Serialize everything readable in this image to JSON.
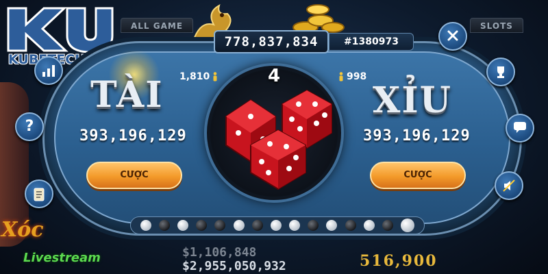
{
  "logo": {
    "text": "KUBETECH.NET"
  },
  "background": {
    "tab_left": "ALL GAME",
    "tab_right": "SLOTS",
    "xoc_label": "Xóc",
    "livestream_label": "Livestream",
    "amount_faded": "$1,106,848",
    "amount": "$2,955,050,932",
    "slot_number": "516,900"
  },
  "header": {
    "jackpot": "778,837,834",
    "session": "#1380973"
  },
  "timer": "4",
  "tai": {
    "label": "TÀI",
    "players": "1,810",
    "total": "393,196,129",
    "bet_label": "CƯỢC"
  },
  "xiu": {
    "label": "XỈU",
    "players": "998",
    "total": "393,196,129",
    "bet_label": "CƯỢC"
  },
  "history": [
    "w",
    "b",
    "w",
    "b",
    "b",
    "w",
    "b",
    "w",
    "w",
    "b",
    "w",
    "b",
    "w",
    "b",
    "w"
  ],
  "colors": {
    "table": "#2b5f8f",
    "bet_button": "#f39a2a",
    "logo": "#2d5d9a"
  },
  "buttons": {
    "left": [
      "chart-icon",
      "help-icon",
      "history-scroll-icon"
    ],
    "right": [
      "close-icon",
      "trophy-icon",
      "chat-icon",
      "sound-off-icon"
    ]
  }
}
